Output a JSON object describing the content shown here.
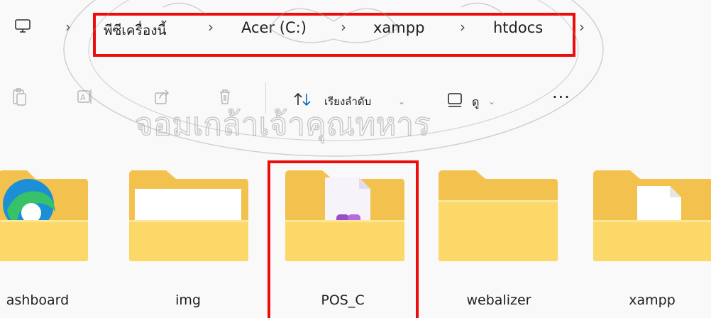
{
  "breadcrumb": {
    "items": [
      {
        "label": "พีซีเครื่องนี้"
      },
      {
        "label": "Acer (C:)"
      },
      {
        "label": "xampp"
      },
      {
        "label": "htdocs"
      }
    ]
  },
  "toolbar": {
    "sort_label": "เรียงลำดับ",
    "view_label": "ดู",
    "more_label": "···"
  },
  "folders": [
    {
      "name": "ashboard",
      "icon": "edge-folder-icon"
    },
    {
      "name": "img",
      "icon": "folder-with-document-icon"
    },
    {
      "name": "POS_C",
      "icon": "folder-with-app-icon"
    },
    {
      "name": "webalizer",
      "icon": "folder-icon"
    },
    {
      "name": "xampp",
      "icon": "folder-with-file-icon"
    }
  ],
  "watermark": {
    "text": "จอมเกล้าเจ้าคุณทหาร"
  },
  "colors": {
    "highlight": "#ec0c0c",
    "folder_back": "#f3c24e",
    "folder_front": "#fcd869",
    "background": "#f9f9f9"
  }
}
